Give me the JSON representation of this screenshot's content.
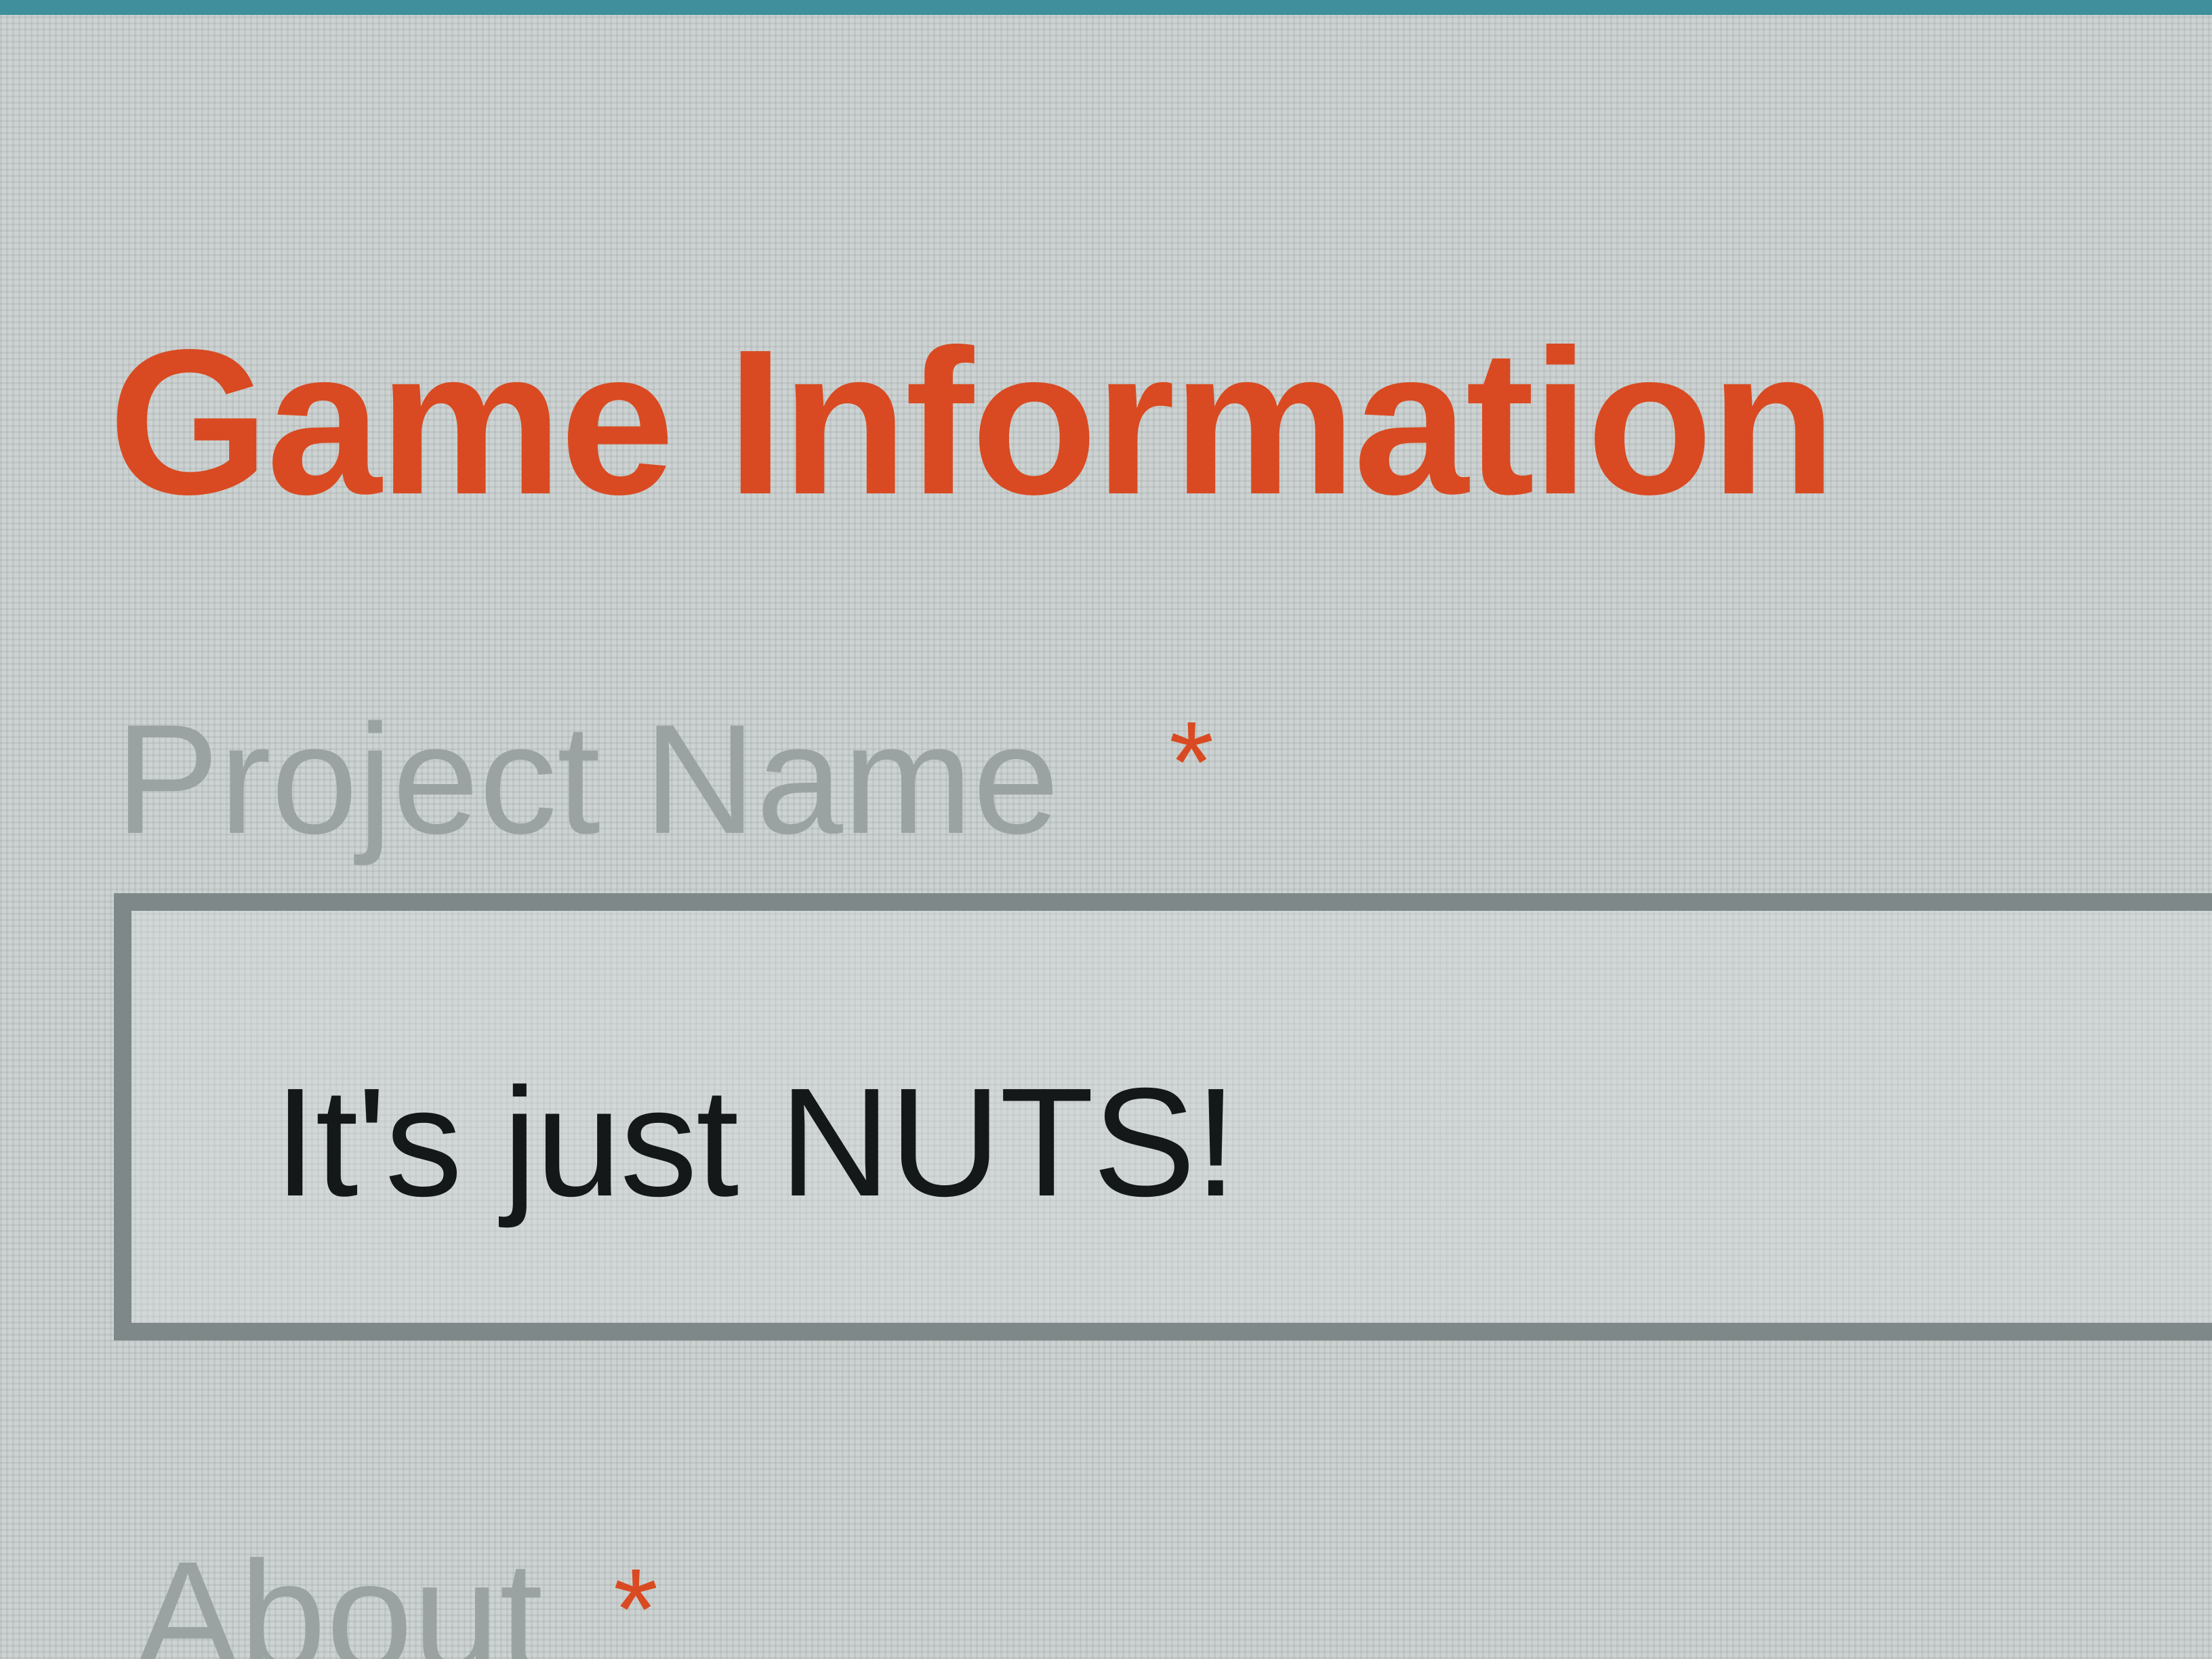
{
  "colors": {
    "accent": "#d94a22",
    "label": "#9aa2a2",
    "input_border": "#7f8888",
    "input_text": "#141818",
    "background": "#cdd3d2"
  },
  "section": {
    "title": "Game Information"
  },
  "fields": {
    "project_name": {
      "label": "Project Name",
      "required_marker": "*",
      "value": "It's just NUTS!"
    },
    "about": {
      "label": "About",
      "required_marker": "*"
    }
  }
}
